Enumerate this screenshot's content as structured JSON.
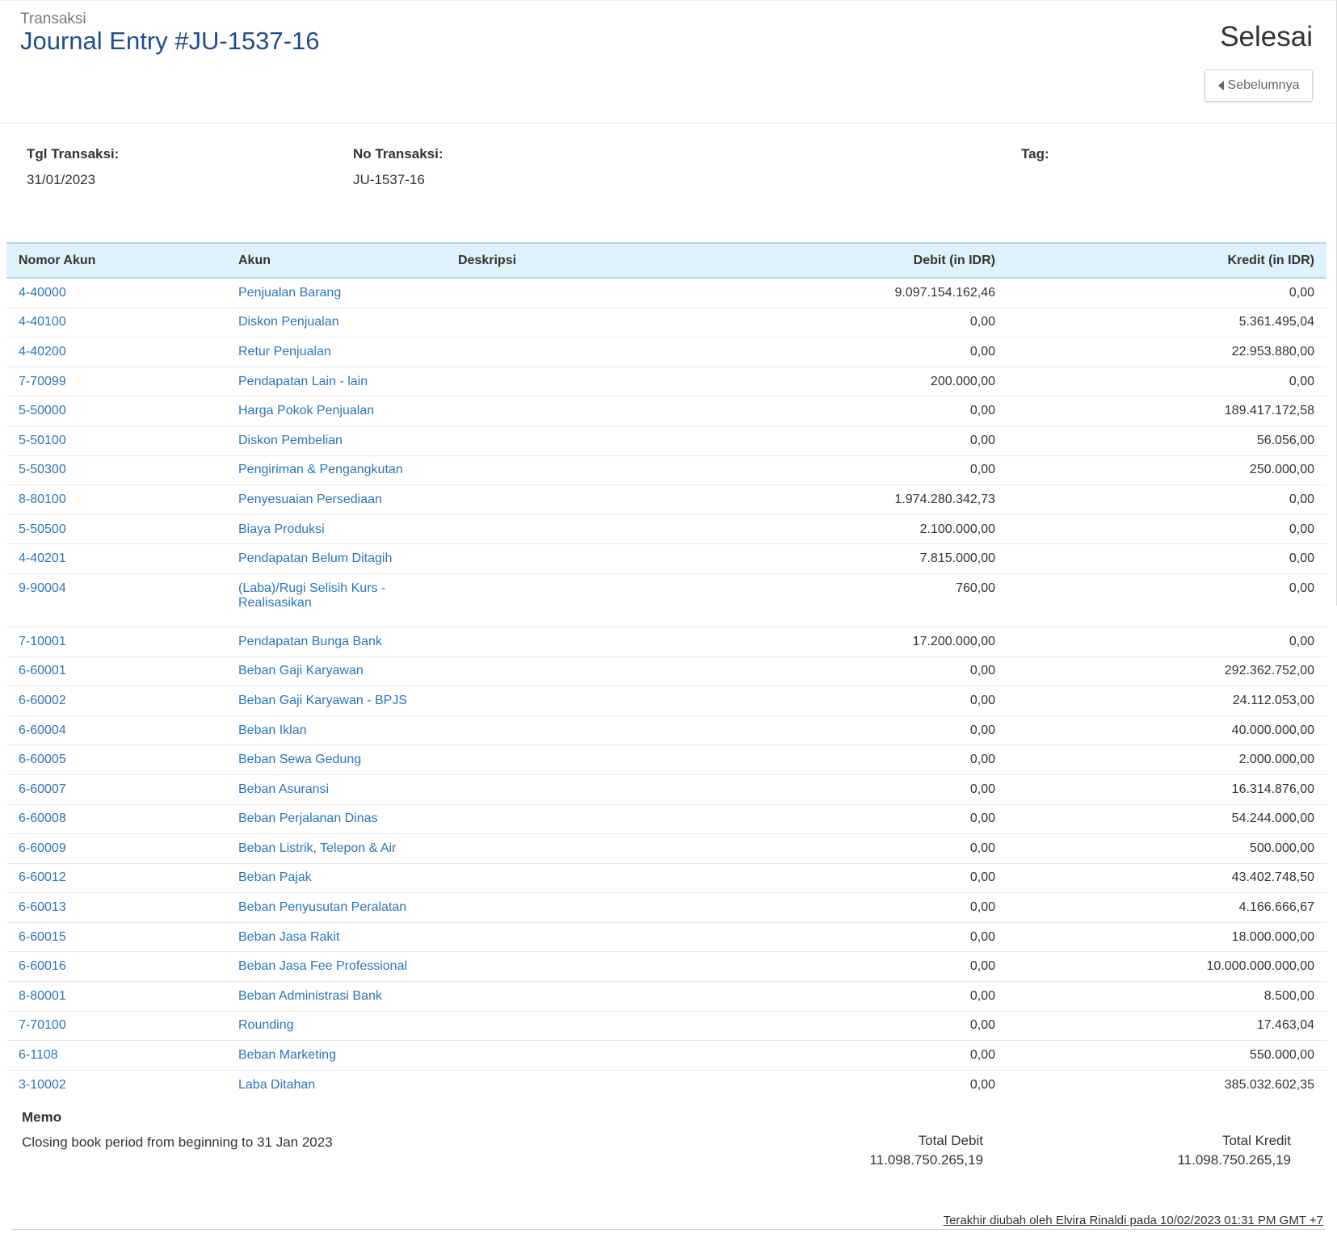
{
  "header": {
    "breadcrumb": "Transaksi",
    "title": "Journal Entry #JU-1537-16",
    "status": "Selesai",
    "prev_button": "Sebelumnya"
  },
  "info": {
    "date_label": "Tgl Transaksi:",
    "date_value": "31/01/2023",
    "number_label": "No Transaksi:",
    "number_value": "JU-1537-16",
    "tag_label": "Tag:"
  },
  "table": {
    "headers": {
      "account_number": "Nomor Akun",
      "account": "Akun",
      "description": "Deskripsi",
      "debit": "Debit (in IDR)",
      "credit": "Kredit (in IDR)"
    },
    "rows": [
      {
        "number": "4-40000",
        "account": "Penjualan Barang",
        "description": "",
        "debit": "9.097.154.162,46",
        "credit": "0,00"
      },
      {
        "number": "4-40100",
        "account": "Diskon Penjualan",
        "description": "",
        "debit": "0,00",
        "credit": "5.361.495,04"
      },
      {
        "number": "4-40200",
        "account": "Retur Penjualan",
        "description": "",
        "debit": "0,00",
        "credit": "22.953.880,00"
      },
      {
        "number": "7-70099",
        "account": "Pendapatan Lain - lain",
        "description": "",
        "debit": "200.000,00",
        "credit": "0,00"
      },
      {
        "number": "5-50000",
        "account": "Harga Pokok Penjualan",
        "description": "",
        "debit": "0,00",
        "credit": "189.417.172,58"
      },
      {
        "number": "5-50100",
        "account": "Diskon Pembelian",
        "description": "",
        "debit": "0,00",
        "credit": "56.056,00"
      },
      {
        "number": "5-50300",
        "account": "Pengiriman & Pengangkutan",
        "description": "",
        "debit": "0,00",
        "credit": "250.000,00"
      },
      {
        "number": "8-80100",
        "account": "Penyesuaian Persediaan",
        "description": "",
        "debit": "1.974.280.342,73",
        "credit": "0,00"
      },
      {
        "number": "5-50500",
        "account": "Biaya Produksi",
        "description": "",
        "debit": "2.100.000,00",
        "credit": "0,00"
      },
      {
        "number": "4-40201",
        "account": "Pendapatan Belum Ditagih",
        "description": "",
        "debit": "7.815.000,00",
        "credit": "0,00"
      },
      {
        "number": "9-90004",
        "account": "(Laba)/Rugi Selisih Kurs - Realisasikan",
        "description": "",
        "debit": "760,00",
        "credit": "0,00"
      },
      {
        "number": "7-10001",
        "account": "Pendapatan Bunga Bank",
        "description": "",
        "debit": "17.200.000,00",
        "credit": "0,00"
      },
      {
        "number": "6-60001",
        "account": "Beban Gaji Karyawan",
        "description": "",
        "debit": "0,00",
        "credit": "292.362.752,00"
      },
      {
        "number": "6-60002",
        "account": "Beban Gaji Karyawan - BPJS",
        "description": "",
        "debit": "0,00",
        "credit": "24.112.053,00"
      },
      {
        "number": "6-60004",
        "account": "Beban Iklan",
        "description": "",
        "debit": "0,00",
        "credit": "40.000.000,00"
      },
      {
        "number": "6-60005",
        "account": "Beban Sewa Gedung",
        "description": "",
        "debit": "0,00",
        "credit": "2.000.000,00"
      },
      {
        "number": "6-60007",
        "account": "Beban Asuransi",
        "description": "",
        "debit": "0,00",
        "credit": "16.314.876,00"
      },
      {
        "number": "6-60008",
        "account": "Beban Perjalanan Dinas",
        "description": "",
        "debit": "0,00",
        "credit": "54.244.000,00"
      },
      {
        "number": "6-60009",
        "account": "Beban Listrik, Telepon & Air",
        "description": "",
        "debit": "0,00",
        "credit": "500.000,00"
      },
      {
        "number": "6-60012",
        "account": "Beban Pajak",
        "description": "",
        "debit": "0,00",
        "credit": "43.402.748,50"
      },
      {
        "number": "6-60013",
        "account": "Beban Penyusutan Peralatan",
        "description": "",
        "debit": "0,00",
        "credit": "4.166.666,67"
      },
      {
        "number": "6-60015",
        "account": "Beban Jasa Rakit",
        "description": "",
        "debit": "0,00",
        "credit": "18.000.000,00"
      },
      {
        "number": "6-60016",
        "account": "Beban Jasa Fee Professional",
        "description": "",
        "debit": "0,00",
        "credit": "10.000.000.000,00"
      },
      {
        "number": "8-80001",
        "account": "Beban Administrasi Bank",
        "description": "",
        "debit": "0,00",
        "credit": "8.500,00"
      },
      {
        "number": "7-70100",
        "account": "Rounding",
        "description": "",
        "debit": "0,00",
        "credit": "17.463,04"
      },
      {
        "number": "6-1108",
        "account": "Beban Marketing",
        "description": "",
        "debit": "0,00",
        "credit": "550.000,00"
      },
      {
        "number": "3-10002",
        "account": "Laba Ditahan",
        "description": "",
        "debit": "0,00",
        "credit": "385.032.602,35"
      }
    ]
  },
  "memo": {
    "label": "Memo",
    "text": "Closing book period from beginning to 31 Jan 2023"
  },
  "totals": {
    "debit_label": "Total Debit",
    "debit_value": "11.098.750.265,19",
    "credit_label": "Total Kredit",
    "credit_value": "11.098.750.265,19"
  },
  "footer": {
    "last_modified": "Terakhir diubah oleh Elvira Rinaldi pada 10/02/2023 01:31 PM GMT +7"
  }
}
